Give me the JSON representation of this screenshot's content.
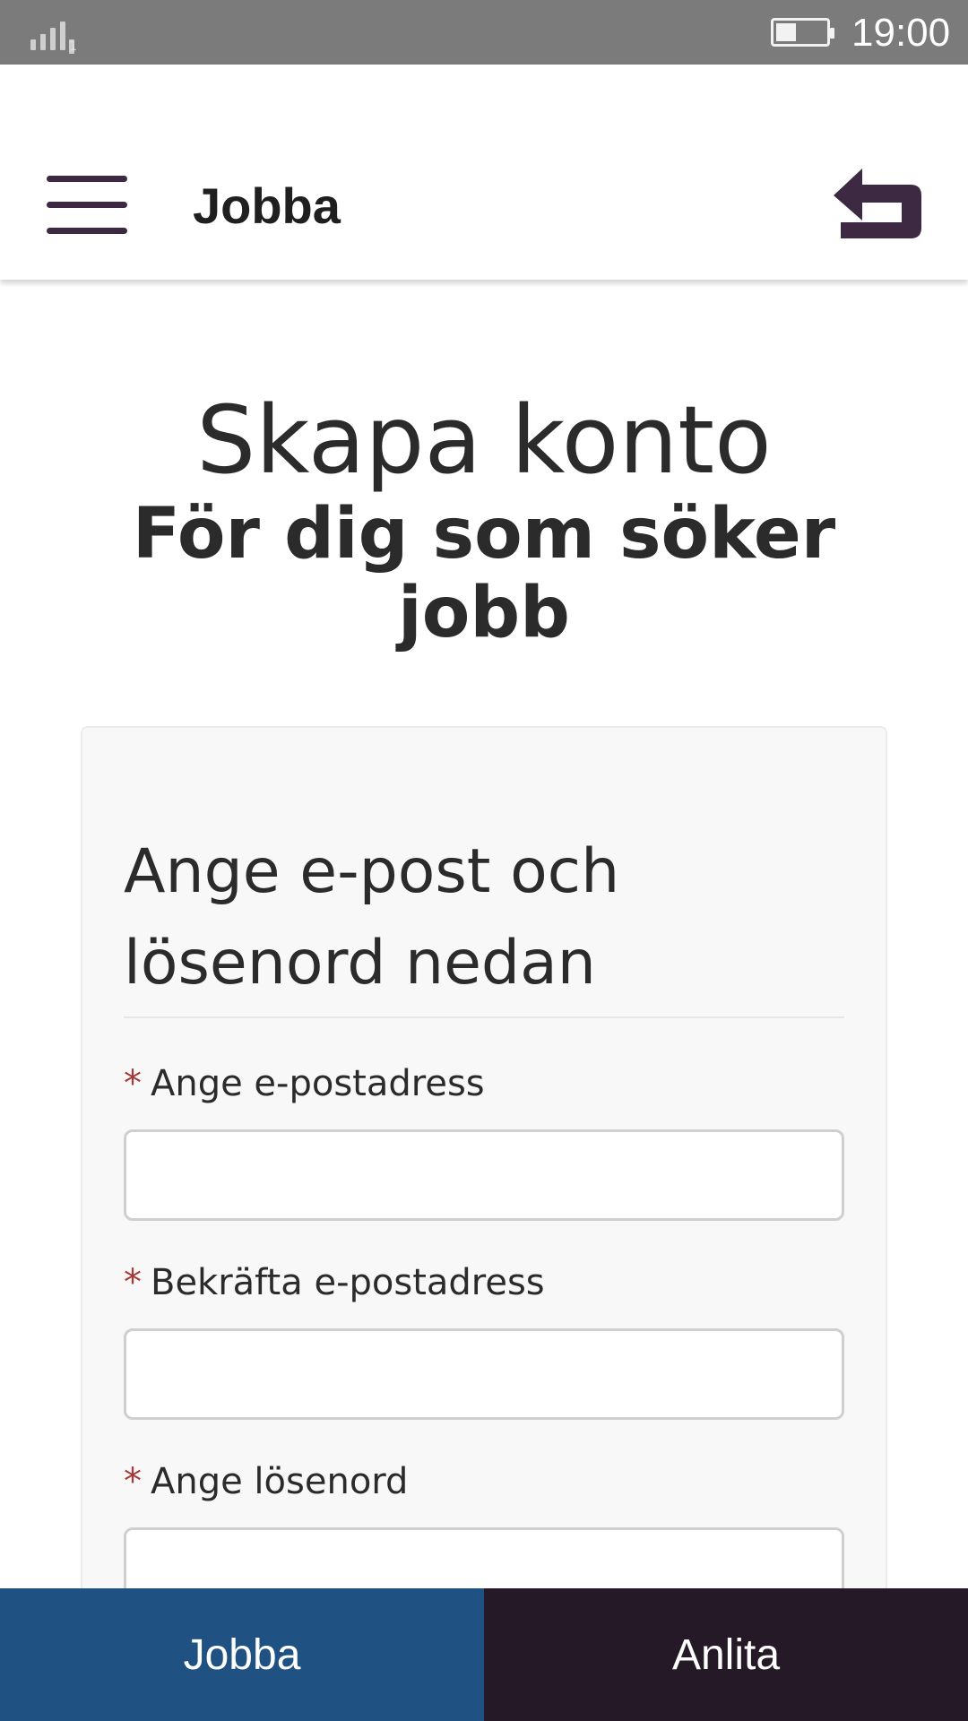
{
  "status_bar": {
    "time": "19:00",
    "signal_sub": "1"
  },
  "app_bar": {
    "title": "Jobba"
  },
  "page": {
    "title": "Skapa konto",
    "subtitle": "För dig som söker jobb"
  },
  "form": {
    "heading": "Ange e-post och lösenord nedan",
    "required_marker": "*",
    "fields": [
      {
        "label": "Ange e-postadress",
        "value": ""
      },
      {
        "label": "Bekräfta e-postadress",
        "value": ""
      },
      {
        "label": "Ange lösenord",
        "value": ""
      }
    ]
  },
  "bottom_tabs": [
    {
      "label": "Jobba"
    },
    {
      "label": "Anlita"
    }
  ],
  "colors": {
    "status_bar": "#7b7b7b",
    "brand_purple": "#3d2a42",
    "tab_jobba": "#1f5282",
    "tab_anlita": "#251927",
    "required": "#a53a3a"
  }
}
